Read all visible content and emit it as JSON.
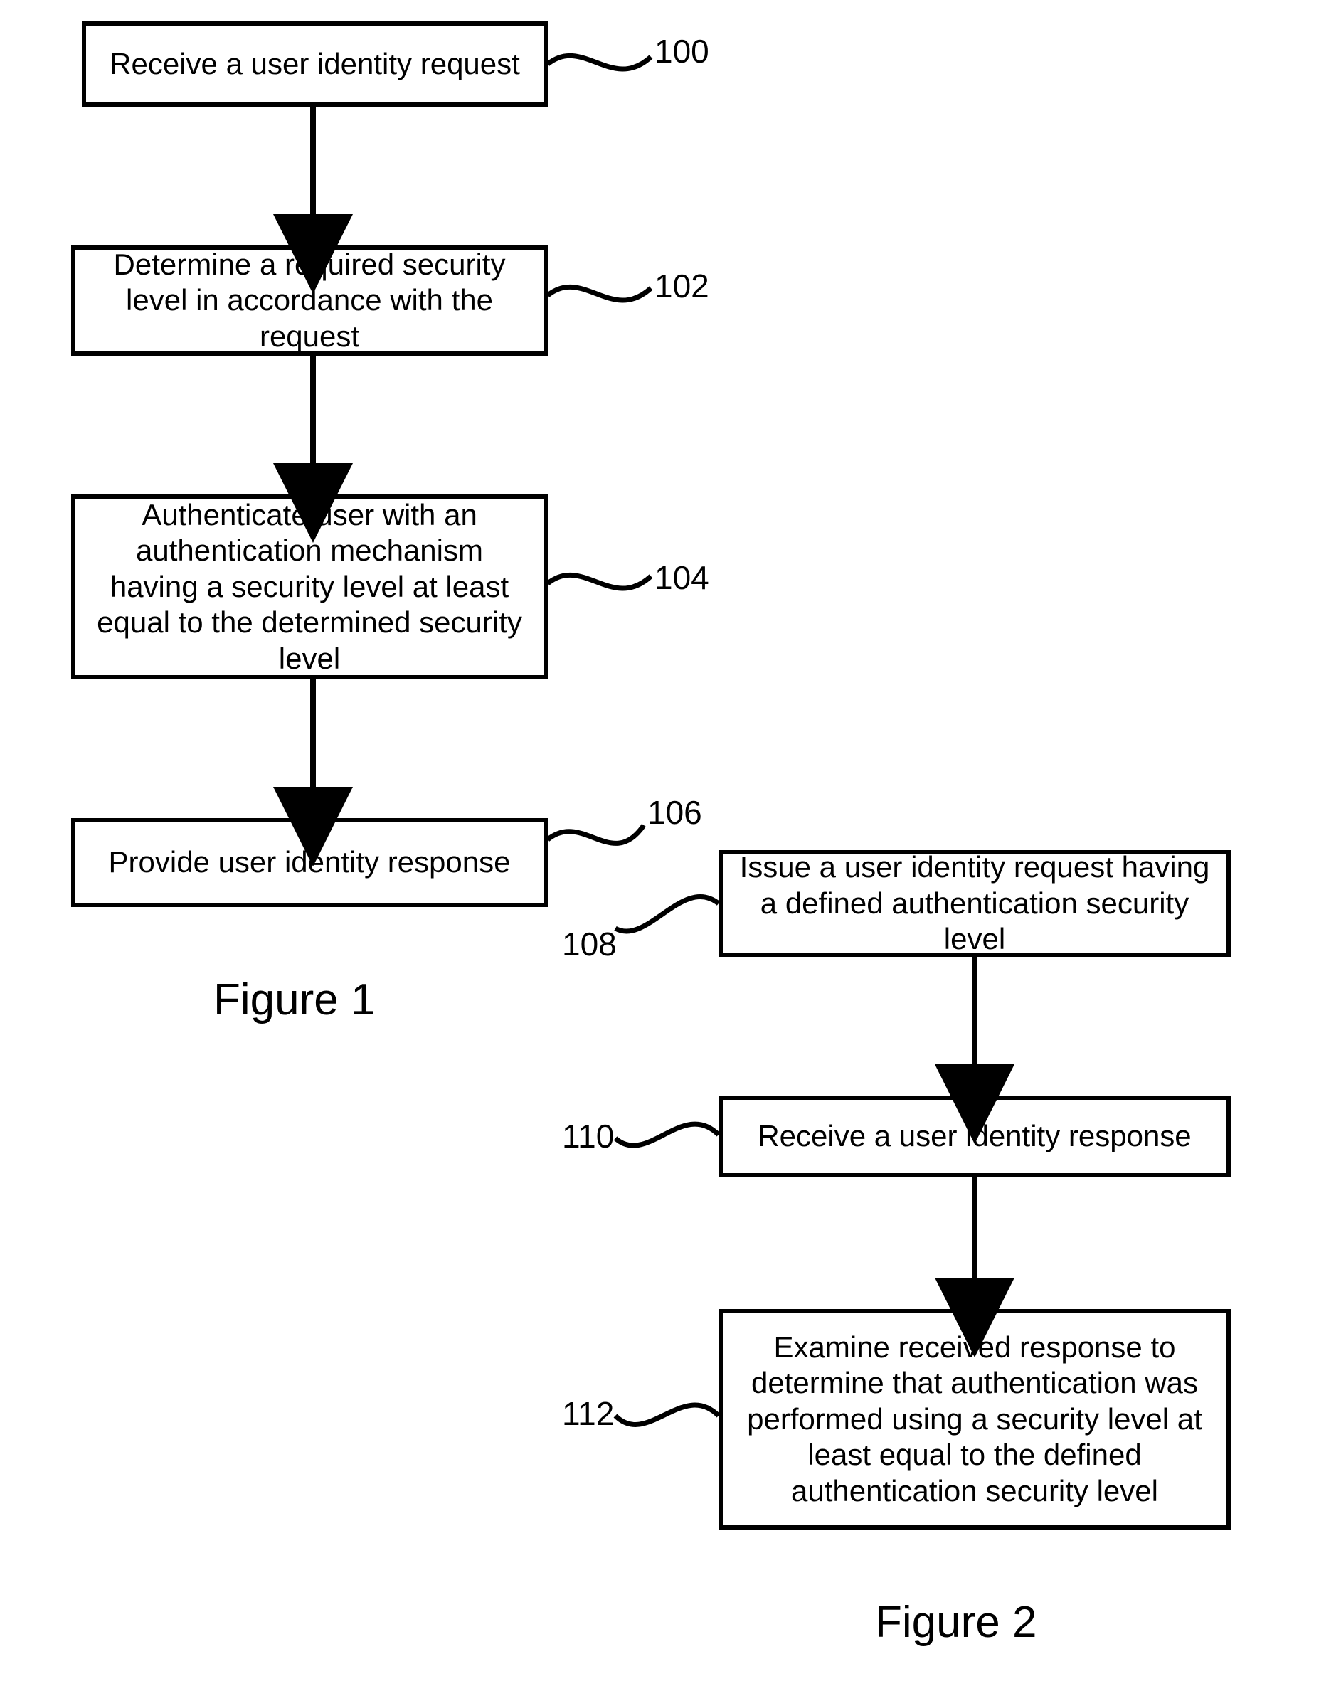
{
  "fig1": {
    "caption": "Figure 1",
    "steps": [
      {
        "id": "100",
        "text": "Receive a user identity request"
      },
      {
        "id": "102",
        "text": "Determine a required security level in accordance with the request"
      },
      {
        "id": "104",
        "text": "Authenticate user with an authentication mechanism having a security level at least equal to the determined security level"
      },
      {
        "id": "106",
        "text": "Provide user identity response"
      }
    ]
  },
  "fig2": {
    "caption": "Figure 2",
    "steps": [
      {
        "id": "108",
        "text": "Issue a user identity request having a defined authentication security level"
      },
      {
        "id": "110",
        "text": "Receive a user identity response"
      },
      {
        "id": "112",
        "text": "Examine received response to determine that authentication was performed using a security level at least equal to the defined authentication security level"
      }
    ]
  }
}
